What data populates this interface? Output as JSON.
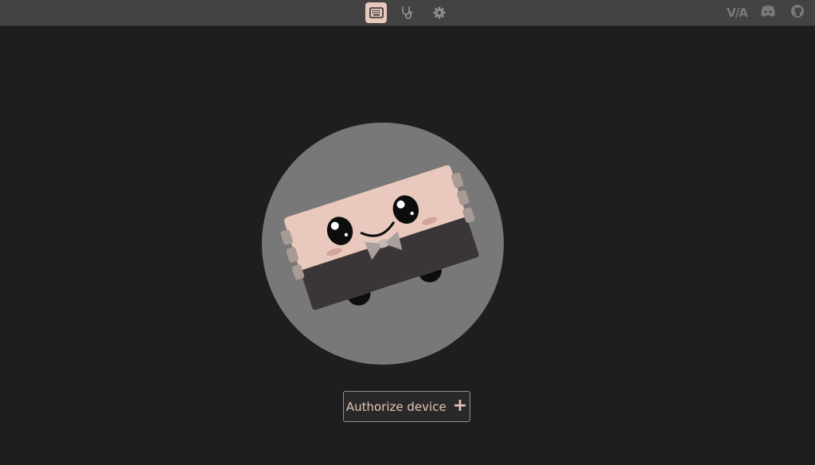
{
  "nav": {
    "tabs": [
      {
        "icon": "keyboard-icon",
        "active": true
      },
      {
        "icon": "stethoscope-icon",
        "active": false
      },
      {
        "icon": "gear-icon",
        "active": false
      }
    ],
    "external": {
      "via_logo": "V/A",
      "discord_icon": "discord-icon",
      "github_icon": "github-icon"
    }
  },
  "main": {
    "mascot_icon": "keyboard-mascot",
    "authorize_label": "Authorize device",
    "authorize_icon": "+"
  },
  "colors": {
    "background": "#1f1e1f",
    "topbar": "#434343",
    "accent": "#e9c9bd",
    "button_text": "#e7c3b7",
    "mascot_circle": "#787878"
  }
}
